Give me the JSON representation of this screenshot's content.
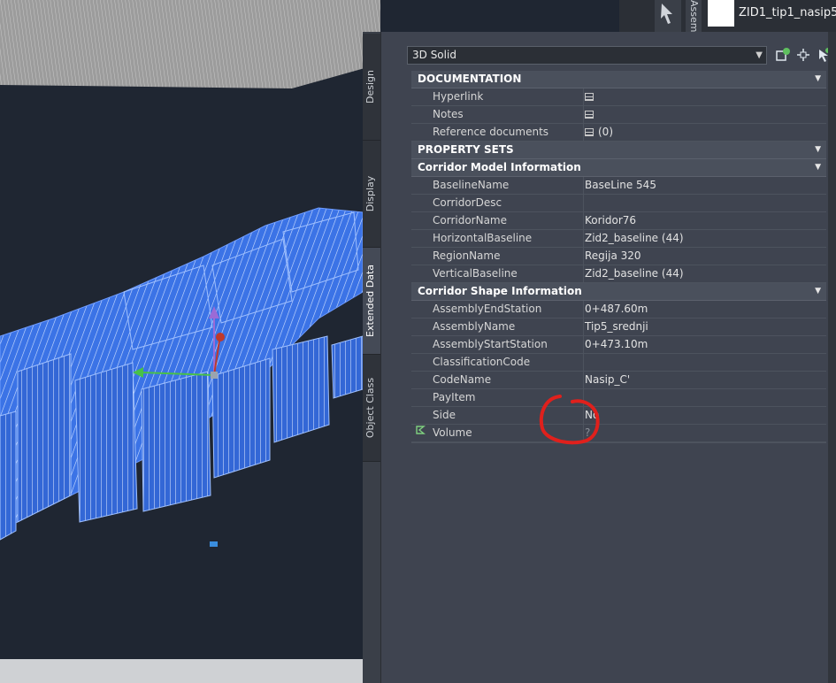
{
  "layer": {
    "name": "ZID1_tip1_nasip5",
    "swatch_color": "#ffffff"
  },
  "assembly_tab": {
    "label": "Assem..."
  },
  "side_tabs": [
    {
      "label": "Design"
    },
    {
      "label": "Display"
    },
    {
      "label": "Extended Data"
    },
    {
      "label": "Object Class"
    }
  ],
  "selector": {
    "value": "3D Solid"
  },
  "toolbar_icons": [
    "quick-select-icon",
    "pick-point-icon",
    "add-selection-icon"
  ],
  "sections": {
    "documentation": {
      "title": "DOCUMENTATION",
      "rows": [
        {
          "name": "Hyperlink",
          "value": ""
        },
        {
          "name": "Notes",
          "value": ""
        },
        {
          "name": "Reference documents",
          "value": "(0)"
        }
      ]
    },
    "property_sets": {
      "title": "PROPERTY SETS"
    },
    "corridor_model": {
      "title": "Corridor Model Information",
      "rows": [
        {
          "name": "BaselineName",
          "value": "BaseLine 545"
        },
        {
          "name": "CorridorDesc",
          "value": ""
        },
        {
          "name": "CorridorName",
          "value": "Koridor76"
        },
        {
          "name": "HorizontalBaseline",
          "value": "Zid2_baseline (44)"
        },
        {
          "name": "RegionName",
          "value": "Regija 320"
        },
        {
          "name": "VerticalBaseline",
          "value": "Zid2_baseline (44)"
        }
      ]
    },
    "corridor_shape": {
      "title": "Corridor Shape Information",
      "rows": [
        {
          "name": "AssemblyEndStation",
          "value": "0+487.60m"
        },
        {
          "name": "AssemblyName",
          "value": "Tip5_srednji"
        },
        {
          "name": "AssemblyStartStation",
          "value": "0+473.10m"
        },
        {
          "name": "ClassificationCode",
          "value": ""
        },
        {
          "name": "CodeName",
          "value": "Nasip_C'"
        },
        {
          "name": "PayItem",
          "value": ""
        },
        {
          "name": "Side",
          "value": "No"
        },
        {
          "name": "Volume",
          "value": "?"
        }
      ]
    }
  },
  "colors": {
    "annotation": "#e0201c",
    "selection": "#3d6fe0"
  }
}
